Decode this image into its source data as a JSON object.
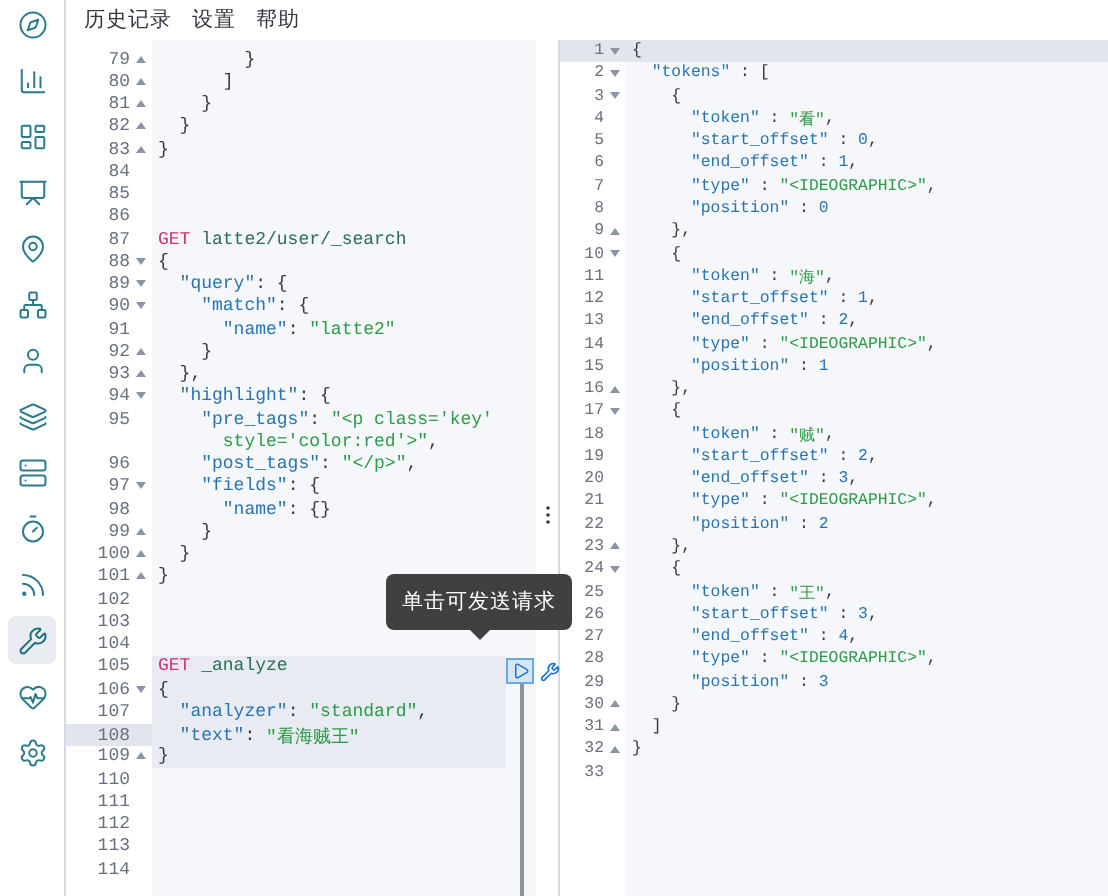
{
  "sidebar": {
    "items": [
      {
        "selected": false
      },
      {
        "selected": false
      },
      {
        "selected": false
      },
      {
        "selected": false
      },
      {
        "selected": false
      },
      {
        "selected": false
      },
      {
        "selected": false
      },
      {
        "selected": false
      },
      {
        "selected": false
      },
      {
        "selected": false
      },
      {
        "selected": false
      },
      {
        "selected": true
      },
      {
        "selected": false
      },
      {
        "selected": false
      }
    ]
  },
  "menu": [
    "历史记录",
    "设置",
    "帮助"
  ],
  "editor": {
    "tooltip": "单击可发送请求",
    "lines": [
      {
        "number": "79",
        "fold": {
          "kind": "end"
        },
        "tokens": [
          {
            "kind": "punct",
            "text": "        }"
          }
        ]
      },
      {
        "number": "80",
        "fold": {
          "kind": "end"
        },
        "tokens": [
          {
            "kind": "punct",
            "text": "      ]"
          }
        ]
      },
      {
        "number": "81",
        "fold": {
          "kind": "end"
        },
        "tokens": [
          {
            "kind": "punct",
            "text": "    }"
          }
        ]
      },
      {
        "number": "82",
        "fold": {
          "kind": "end"
        },
        "tokens": [
          {
            "kind": "punct",
            "text": "  }"
          }
        ]
      },
      {
        "number": "83",
        "fold": {
          "kind": "end"
        },
        "tokens": [
          {
            "kind": "punct",
            "text": "}"
          }
        ]
      },
      {
        "number": "84"
      },
      {
        "number": "85"
      },
      {
        "number": "86"
      },
      {
        "number": "87",
        "tokens": [
          {
            "kind": "method",
            "text": "GET"
          },
          {
            "kind": "path",
            "text": " latte2/user/_search"
          }
        ]
      },
      {
        "number": "88",
        "fold": {
          "kind": "start"
        },
        "tokens": [
          {
            "kind": "punct",
            "text": "{"
          }
        ]
      },
      {
        "number": "89",
        "fold": {
          "kind": "start"
        },
        "tokens": [
          {
            "kind": "key",
            "text": "  \"query\""
          },
          {
            "kind": "punct",
            "text": ": {"
          }
        ]
      },
      {
        "number": "90",
        "fold": {
          "kind": "start"
        },
        "tokens": [
          {
            "kind": "key",
            "text": "    \"match\""
          },
          {
            "kind": "punct",
            "text": ": {"
          }
        ]
      },
      {
        "number": "91",
        "tokens": [
          {
            "kind": "key",
            "text": "      \"name\""
          },
          {
            "kind": "punct",
            "text": ": "
          },
          {
            "kind": "string",
            "text": "\"latte2\""
          }
        ]
      },
      {
        "number": "92",
        "fold": {
          "kind": "end"
        },
        "tokens": [
          {
            "kind": "punct",
            "text": "    }"
          }
        ]
      },
      {
        "number": "93",
        "fold": {
          "kind": "end"
        },
        "tokens": [
          {
            "kind": "punct",
            "text": "  },"
          }
        ]
      },
      {
        "number": "94",
        "fold": {
          "kind": "start"
        },
        "tokens": [
          {
            "kind": "key",
            "text": "  \"highlight\""
          },
          {
            "kind": "punct",
            "text": ": {"
          }
        ]
      },
      {
        "number": "95",
        "tokens": [
          {
            "kind": "key",
            "text": "    \"pre_tags\""
          },
          {
            "kind": "punct",
            "text": ": "
          },
          {
            "kind": "string",
            "text": "\"<p class='key'"
          }
        ]
      },
      {
        "tokens": [
          {
            "kind": "string",
            "text": "      style='color:red'>\""
          },
          {
            "kind": "punct",
            "text": ","
          }
        ]
      },
      {
        "number": "96",
        "tokens": [
          {
            "kind": "key",
            "text": "    \"post_tags\""
          },
          {
            "kind": "punct",
            "text": ": "
          },
          {
            "kind": "string",
            "text": "\"</p>\""
          },
          {
            "kind": "punct",
            "text": ","
          }
        ]
      },
      {
        "number": "97",
        "fold": {
          "kind": "start"
        },
        "tokens": [
          {
            "kind": "key",
            "text": "    \"fields\""
          },
          {
            "kind": "punct",
            "text": ": {"
          }
        ]
      },
      {
        "number": "98",
        "tokens": [
          {
            "kind": "key",
            "text": "      \"name\""
          },
          {
            "kind": "punct",
            "text": ": {}"
          }
        ]
      },
      {
        "number": "99",
        "fold": {
          "kind": "end"
        },
        "tokens": [
          {
            "kind": "punct",
            "text": "    }"
          }
        ]
      },
      {
        "number": "100",
        "fold": {
          "kind": "end"
        },
        "tokens": [
          {
            "kind": "punct",
            "text": "  }"
          }
        ]
      },
      {
        "number": "101",
        "fold": {
          "kind": "end"
        },
        "tokens": [
          {
            "kind": "punct",
            "text": "}"
          }
        ]
      },
      {
        "number": "102"
      },
      {
        "number": "103"
      },
      {
        "number": "104"
      },
      {
        "number": "105",
        "request": true,
        "tokens": [
          {
            "kind": "method",
            "text": "GET"
          },
          {
            "kind": "path",
            "text": " _analyze"
          }
        ]
      },
      {
        "number": "106",
        "request": true,
        "fold": {
          "kind": "start"
        },
        "tokens": [
          {
            "kind": "punct",
            "text": "{"
          }
        ]
      },
      {
        "number": "107",
        "request": true,
        "tokens": [
          {
            "kind": "key",
            "text": "  \"analyzer\""
          },
          {
            "kind": "punct",
            "text": ": "
          },
          {
            "kind": "string",
            "text": "\"standard\""
          },
          {
            "kind": "punct",
            "text": ","
          }
        ]
      },
      {
        "number": "108",
        "request": true,
        "active": true,
        "tokens": [
          {
            "kind": "key",
            "text": "  \"text\""
          },
          {
            "kind": "punct",
            "text": ": "
          },
          {
            "kind": "string",
            "text": "\"看海贼王\""
          }
        ]
      },
      {
        "number": "109",
        "request": true,
        "fold": {
          "kind": "end"
        },
        "tokens": [
          {
            "kind": "punct",
            "text": "}"
          }
        ]
      },
      {
        "number": "110"
      },
      {
        "number": "111"
      },
      {
        "number": "112"
      },
      {
        "number": "113"
      },
      {
        "number": "114"
      }
    ]
  },
  "output": {
    "lines": [
      {
        "number": "1",
        "active": true,
        "fold": {
          "kind": "start"
        },
        "tokens": [
          {
            "kind": "punct",
            "text": "{"
          }
        ]
      },
      {
        "number": "2",
        "fold": {
          "kind": "start"
        },
        "tokens": [
          {
            "kind": "key",
            "text": "  \"tokens\""
          },
          {
            "kind": "punct",
            "text": " : ["
          }
        ]
      },
      {
        "number": "3",
        "fold": {
          "kind": "start"
        },
        "tokens": [
          {
            "kind": "punct",
            "text": "    {"
          }
        ]
      },
      {
        "number": "4",
        "tokens": [
          {
            "kind": "key",
            "text": "      \"token\""
          },
          {
            "kind": "punct",
            "text": " : "
          },
          {
            "kind": "string",
            "text": "\"看\""
          },
          {
            "kind": "punct",
            "text": ","
          }
        ]
      },
      {
        "number": "5",
        "tokens": [
          {
            "kind": "key",
            "text": "      \"start_offset\""
          },
          {
            "kind": "punct",
            "text": " : "
          },
          {
            "kind": "number",
            "text": "0"
          },
          {
            "kind": "punct",
            "text": ","
          }
        ]
      },
      {
        "number": "6",
        "tokens": [
          {
            "kind": "key",
            "text": "      \"end_offset\""
          },
          {
            "kind": "punct",
            "text": " : "
          },
          {
            "kind": "number",
            "text": "1"
          },
          {
            "kind": "punct",
            "text": ","
          }
        ]
      },
      {
        "number": "7",
        "tokens": [
          {
            "kind": "key",
            "text": "      \"type\""
          },
          {
            "kind": "punct",
            "text": " : "
          },
          {
            "kind": "string",
            "text": "\"<IDEOGRAPHIC>\""
          },
          {
            "kind": "punct",
            "text": ","
          }
        ]
      },
      {
        "number": "8",
        "tokens": [
          {
            "kind": "key",
            "text": "      \"position\""
          },
          {
            "kind": "punct",
            "text": " : "
          },
          {
            "kind": "number",
            "text": "0"
          }
        ]
      },
      {
        "number": "9",
        "fold": {
          "kind": "end"
        },
        "tokens": [
          {
            "kind": "punct",
            "text": "    },"
          }
        ]
      },
      {
        "number": "10",
        "fold": {
          "kind": "start"
        },
        "tokens": [
          {
            "kind": "punct",
            "text": "    {"
          }
        ]
      },
      {
        "number": "11",
        "tokens": [
          {
            "kind": "key",
            "text": "      \"token\""
          },
          {
            "kind": "punct",
            "text": " : "
          },
          {
            "kind": "string",
            "text": "\"海\""
          },
          {
            "kind": "punct",
            "text": ","
          }
        ]
      },
      {
        "number": "12",
        "tokens": [
          {
            "kind": "key",
            "text": "      \"start_offset\""
          },
          {
            "kind": "punct",
            "text": " : "
          },
          {
            "kind": "number",
            "text": "1"
          },
          {
            "kind": "punct",
            "text": ","
          }
        ]
      },
      {
        "number": "13",
        "tokens": [
          {
            "kind": "key",
            "text": "      \"end_offset\""
          },
          {
            "kind": "punct",
            "text": " : "
          },
          {
            "kind": "number",
            "text": "2"
          },
          {
            "kind": "punct",
            "text": ","
          }
        ]
      },
      {
        "number": "14",
        "tokens": [
          {
            "kind": "key",
            "text": "      \"type\""
          },
          {
            "kind": "punct",
            "text": " : "
          },
          {
            "kind": "string",
            "text": "\"<IDEOGRAPHIC>\""
          },
          {
            "kind": "punct",
            "text": ","
          }
        ]
      },
      {
        "number": "15",
        "tokens": [
          {
            "kind": "key",
            "text": "      \"position\""
          },
          {
            "kind": "punct",
            "text": " : "
          },
          {
            "kind": "number",
            "text": "1"
          }
        ]
      },
      {
        "number": "16",
        "fold": {
          "kind": "end"
        },
        "tokens": [
          {
            "kind": "punct",
            "text": "    },"
          }
        ]
      },
      {
        "number": "17",
        "fold": {
          "kind": "start"
        },
        "tokens": [
          {
            "kind": "punct",
            "text": "    {"
          }
        ]
      },
      {
        "number": "18",
        "tokens": [
          {
            "kind": "key",
            "text": "      \"token\""
          },
          {
            "kind": "punct",
            "text": " : "
          },
          {
            "kind": "string",
            "text": "\"贼\""
          },
          {
            "kind": "punct",
            "text": ","
          }
        ]
      },
      {
        "number": "19",
        "tokens": [
          {
            "kind": "key",
            "text": "      \"start_offset\""
          },
          {
            "kind": "punct",
            "text": " : "
          },
          {
            "kind": "number",
            "text": "2"
          },
          {
            "kind": "punct",
            "text": ","
          }
        ]
      },
      {
        "number": "20",
        "tokens": [
          {
            "kind": "key",
            "text": "      \"end_offset\""
          },
          {
            "kind": "punct",
            "text": " : "
          },
          {
            "kind": "number",
            "text": "3"
          },
          {
            "kind": "punct",
            "text": ","
          }
        ]
      },
      {
        "number": "21",
        "tokens": [
          {
            "kind": "key",
            "text": "      \"type\""
          },
          {
            "kind": "punct",
            "text": " : "
          },
          {
            "kind": "string",
            "text": "\"<IDEOGRAPHIC>\""
          },
          {
            "kind": "punct",
            "text": ","
          }
        ]
      },
      {
        "number": "22",
        "tokens": [
          {
            "kind": "key",
            "text": "      \"position\""
          },
          {
            "kind": "punct",
            "text": " : "
          },
          {
            "kind": "number",
            "text": "2"
          }
        ]
      },
      {
        "number": "23",
        "fold": {
          "kind": "end"
        },
        "tokens": [
          {
            "kind": "punct",
            "text": "    },"
          }
        ]
      },
      {
        "number": "24",
        "fold": {
          "kind": "start"
        },
        "tokens": [
          {
            "kind": "punct",
            "text": "    {"
          }
        ]
      },
      {
        "number": "25",
        "tokens": [
          {
            "kind": "key",
            "text": "      \"token\""
          },
          {
            "kind": "punct",
            "text": " : "
          },
          {
            "kind": "string",
            "text": "\"王\""
          },
          {
            "kind": "punct",
            "text": ","
          }
        ]
      },
      {
        "number": "26",
        "tokens": [
          {
            "kind": "key",
            "text": "      \"start_offset\""
          },
          {
            "kind": "punct",
            "text": " : "
          },
          {
            "kind": "number",
            "text": "3"
          },
          {
            "kind": "punct",
            "text": ","
          }
        ]
      },
      {
        "number": "27",
        "tokens": [
          {
            "kind": "key",
            "text": "      \"end_offset\""
          },
          {
            "kind": "punct",
            "text": " : "
          },
          {
            "kind": "number",
            "text": "4"
          },
          {
            "kind": "punct",
            "text": ","
          }
        ]
      },
      {
        "number": "28",
        "tokens": [
          {
            "kind": "key",
            "text": "      \"type\""
          },
          {
            "kind": "punct",
            "text": " : "
          },
          {
            "kind": "string",
            "text": "\"<IDEOGRAPHIC>\""
          },
          {
            "kind": "punct",
            "text": ","
          }
        ]
      },
      {
        "number": "29",
        "tokens": [
          {
            "kind": "key",
            "text": "      \"position\""
          },
          {
            "kind": "punct",
            "text": " : "
          },
          {
            "kind": "number",
            "text": "3"
          }
        ]
      },
      {
        "number": "30",
        "fold": {
          "kind": "end"
        },
        "tokens": [
          {
            "kind": "punct",
            "text": "    }"
          }
        ]
      },
      {
        "number": "31",
        "fold": {
          "kind": "end"
        },
        "tokens": [
          {
            "kind": "punct",
            "text": "  ]"
          }
        ]
      },
      {
        "number": "32",
        "fold": {
          "kind": "end"
        },
        "tokens": [
          {
            "kind": "punct",
            "text": "}"
          }
        ]
      },
      {
        "number": "33"
      }
    ]
  }
}
